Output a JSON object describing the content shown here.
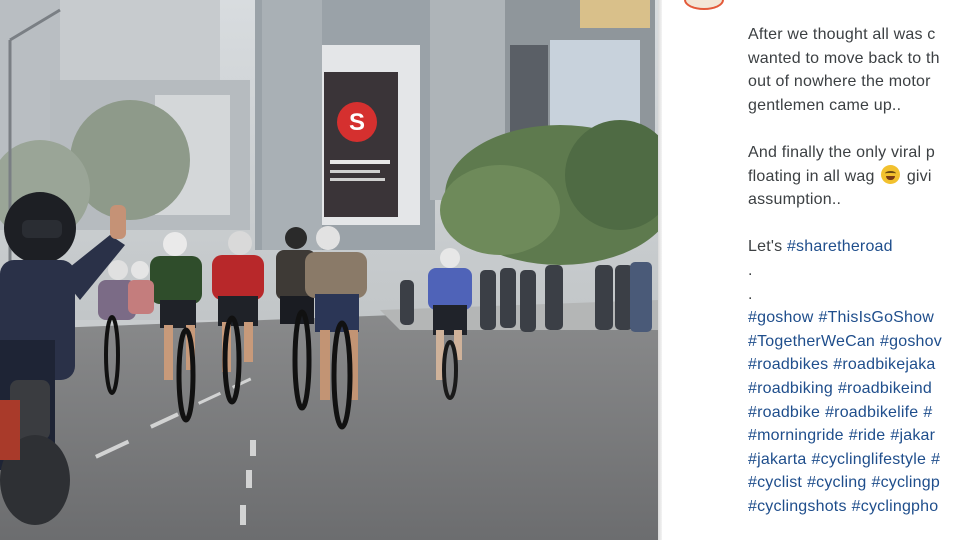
{
  "post": {
    "caption_lines_top": [
      "After we thought all was c",
      "wanted to move back to th",
      "out of nowhere the motor",
      "gentlemen came up.."
    ],
    "caption_line_5a": "And finally the only viral p",
    "caption_line_6a": "floating in all wag ",
    "caption_line_6b": " givi",
    "caption_line_7": "assumption..",
    "lets_prefix": "Let's ",
    "lets_tag": "#sharetheroad",
    "dot1": ".",
    "dot2": ".",
    "hashtag_rows": [
      [
        "#goshow",
        "#ThisIsGoShow"
      ],
      [
        "#TogetherWeCan",
        "#goshov"
      ],
      [
        "#roadbikes",
        "#roadbikejaka"
      ],
      [
        "#roadbiking",
        "#roadbikeind"
      ],
      [
        "#roadbike",
        "#roadbikelife",
        "#"
      ],
      [
        "#morningride",
        "#ride",
        "#jakar"
      ],
      [
        "#jakarta",
        "#cyclinglifestyle",
        "#"
      ],
      [
        "#cyclist",
        "#cycling",
        "#cyclingp"
      ],
      [
        "#cyclingshots",
        "#cyclingpho"
      ]
    ],
    "emoji": "grinning-sweat-face"
  },
  "photo": {
    "billboard_text": "S"
  },
  "colors": {
    "hashtag": "#1f4e8c",
    "text": "#3c4043",
    "avatar_ring": "#e35a3a"
  }
}
